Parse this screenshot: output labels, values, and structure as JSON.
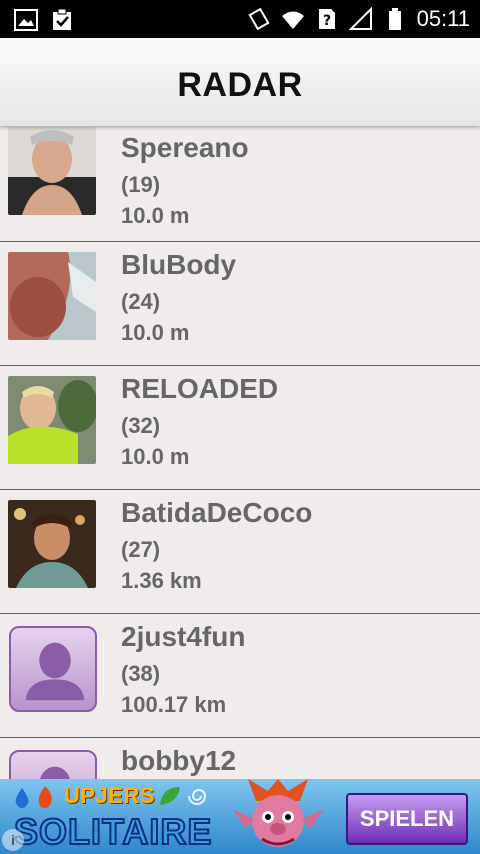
{
  "status_bar": {
    "time": "05:11"
  },
  "header": {
    "title": "RADAR"
  },
  "users": [
    {
      "name": "Spereano",
      "age": "(19)",
      "distance": "10.0 m",
      "avatar": "photo"
    },
    {
      "name": "BluBody",
      "age": "(24)",
      "distance": "10.0 m",
      "avatar": "photo"
    },
    {
      "name": "RELOADED",
      "age": "(32)",
      "distance": "10.0 m",
      "avatar": "photo"
    },
    {
      "name": "BatidaDeCoco",
      "age": "(27)",
      "distance": "1.36 km",
      "avatar": "photo"
    },
    {
      "name": "2just4fun",
      "age": "(38)",
      "distance": "100.17 km",
      "avatar": "placeholder"
    },
    {
      "name": "bobby12",
      "age": "",
      "distance": "",
      "avatar": "placeholder"
    }
  ],
  "ad": {
    "brand": "UPJERS",
    "title": "SOLITAIRE",
    "cta": "SPIELEN",
    "info_icon": "i"
  }
}
